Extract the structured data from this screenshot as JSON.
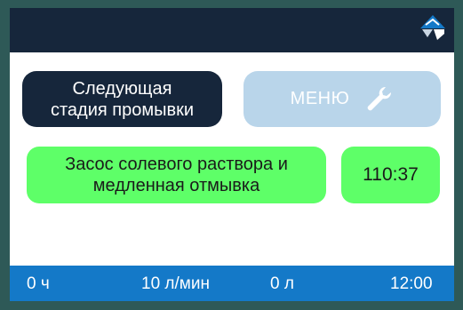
{
  "topbar": {
    "logo_icon": "company-logo-icon"
  },
  "buttons": {
    "next_stage_line1": "Следующая",
    "next_stage_line2": "стадия промывки",
    "menu_label": "МЕНЮ",
    "menu_icon": "wrench-icon"
  },
  "status": {
    "line1": "Засос солевого раствора и",
    "line2": "медленная отмывка",
    "timer": "110:37"
  },
  "footer": {
    "hours": "0 ч",
    "flow": "10 л/мин",
    "volume": "0 л",
    "clock": "12:00"
  },
  "colors": {
    "topbar": "#16263b",
    "menu_button": "#b9d5ea",
    "status_green": "#5eff68",
    "footer_blue": "#1479c8"
  }
}
